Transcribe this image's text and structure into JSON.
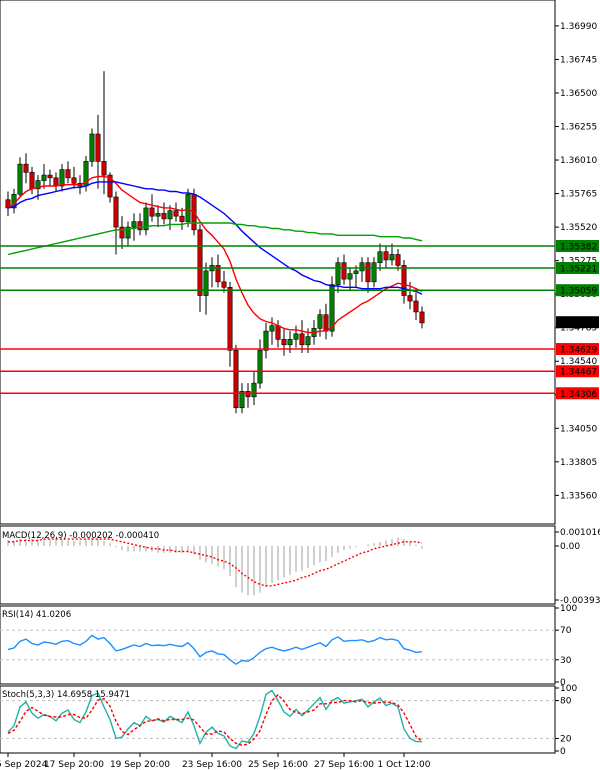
{
  "chart_data": {
    "type": "candlestick",
    "title": "",
    "main_panel": {
      "y_axis_ticks": [
        "1.36990",
        "1.36745",
        "1.36500",
        "1.36255",
        "1.36010",
        "1.35765",
        "1.35520",
        "1.35275",
        "1.35030",
        "1.34785",
        "1.34540",
        "1.34295",
        "1.34050",
        "1.33805",
        "1.33560"
      ],
      "ylim": [
        1.3338,
        1.3715
      ],
      "current_price": "1.34825",
      "current_price_value": 1.34825,
      "horizontal_levels": [
        {
          "label": "1.35382",
          "value": 1.35382,
          "color": "#008000"
        },
        {
          "label": "1.35221",
          "value": 1.35221,
          "color": "#008000"
        },
        {
          "label": "1.35059",
          "value": 1.35059,
          "color": "#008000"
        },
        {
          "label": "1.34629",
          "value": 1.34629,
          "color": "#ff0000"
        },
        {
          "label": "1.34467",
          "value": 1.34467,
          "color": "#ff0000"
        },
        {
          "label": "1.34306",
          "value": 1.34306,
          "color": "#ff0000"
        }
      ],
      "candles": [
        [
          1.3572,
          1.3578,
          1.356,
          1.3566
        ],
        [
          1.3566,
          1.358,
          1.3562,
          1.3576
        ],
        [
          1.3576,
          1.3603,
          1.3574,
          1.3598
        ],
        [
          1.3598,
          1.3606,
          1.3584,
          1.3592
        ],
        [
          1.3592,
          1.3596,
          1.3576,
          1.358
        ],
        [
          1.358,
          1.359,
          1.3572,
          1.3586
        ],
        [
          1.3586,
          1.3598,
          1.358,
          1.359
        ],
        [
          1.359,
          1.3594,
          1.3582,
          1.3588
        ],
        [
          1.3588,
          1.3592,
          1.3578,
          1.3582
        ],
        [
          1.3582,
          1.3598,
          1.3578,
          1.3594
        ],
        [
          1.3594,
          1.36,
          1.3584,
          1.3588
        ],
        [
          1.3588,
          1.3596,
          1.358,
          1.3584
        ],
        [
          1.3584,
          1.359,
          1.3576,
          1.3582
        ],
        [
          1.3582,
          1.3604,
          1.3578,
          1.36
        ],
        [
          1.36,
          1.3624,
          1.3596,
          1.362
        ],
        [
          1.362,
          1.3634,
          1.358,
          1.36
        ],
        [
          1.36,
          1.3666,
          1.3576,
          1.359
        ],
        [
          1.359,
          1.3592,
          1.357,
          1.3574
        ],
        [
          1.3574,
          1.3578,
          1.3532,
          1.3552
        ],
        [
          1.3552,
          1.356,
          1.3536,
          1.3544
        ],
        [
          1.3544,
          1.3556,
          1.3538,
          1.3552
        ],
        [
          1.3552,
          1.3562,
          1.3542,
          1.3556
        ],
        [
          1.3556,
          1.3562,
          1.3546,
          1.355
        ],
        [
          1.355,
          1.357,
          1.3546,
          1.3566
        ],
        [
          1.3566,
          1.3576,
          1.3556,
          1.356
        ],
        [
          1.356,
          1.3568,
          1.3552,
          1.3562
        ],
        [
          1.3562,
          1.357,
          1.3554,
          1.3558
        ],
        [
          1.3558,
          1.3568,
          1.355,
          1.3564
        ],
        [
          1.3564,
          1.357,
          1.3556,
          1.356
        ],
        [
          1.356,
          1.3566,
          1.355,
          1.3556
        ],
        [
          1.3556,
          1.358,
          1.3552,
          1.3576
        ],
        [
          1.3576,
          1.358,
          1.3546,
          1.355
        ],
        [
          1.355,
          1.3554,
          1.349,
          1.3502
        ],
        [
          1.3502,
          1.3526,
          1.3488,
          1.352
        ],
        [
          1.352,
          1.353,
          1.3508,
          1.3524
        ],
        [
          1.3524,
          1.3532,
          1.3508,
          1.3512
        ],
        [
          1.3512,
          1.352,
          1.3504,
          1.3508
        ],
        [
          1.3508,
          1.3512,
          1.345,
          1.3462
        ],
        [
          1.3462,
          1.3466,
          1.3416,
          1.342
        ],
        [
          1.342,
          1.3438,
          1.3416,
          1.3432
        ],
        [
          1.3432,
          1.3438,
          1.342,
          1.3428
        ],
        [
          1.3428,
          1.3446,
          1.3422,
          1.3438
        ],
        [
          1.3438,
          1.347,
          1.3434,
          1.3462
        ],
        [
          1.3462,
          1.3482,
          1.3456,
          1.3476
        ],
        [
          1.3476,
          1.3486,
          1.3466,
          1.348
        ],
        [
          1.348,
          1.3484,
          1.3464,
          1.347
        ],
        [
          1.347,
          1.3478,
          1.3458,
          1.3466
        ],
        [
          1.3466,
          1.3476,
          1.346,
          1.347
        ],
        [
          1.347,
          1.348,
          1.3464,
          1.3474
        ],
        [
          1.3474,
          1.3484,
          1.346,
          1.3466
        ],
        [
          1.3466,
          1.3478,
          1.346,
          1.3472
        ],
        [
          1.3472,
          1.3484,
          1.3466,
          1.3478
        ],
        [
          1.3478,
          1.3492,
          1.3472,
          1.3488
        ],
        [
          1.3488,
          1.3496,
          1.347,
          1.3476
        ],
        [
          1.3476,
          1.3516,
          1.3472,
          1.351
        ],
        [
          1.351,
          1.353,
          1.3504,
          1.3526
        ],
        [
          1.3526,
          1.3532,
          1.351,
          1.3514
        ],
        [
          1.3514,
          1.3522,
          1.3506,
          1.3518
        ],
        [
          1.3518,
          1.3524,
          1.3508,
          1.352
        ],
        [
          1.352,
          1.353,
          1.3512,
          1.3526
        ],
        [
          1.3526,
          1.353,
          1.3504,
          1.3512
        ],
        [
          1.3512,
          1.353,
          1.3508,
          1.3526
        ],
        [
          1.3526,
          1.354,
          1.352,
          1.3534
        ],
        [
          1.3534,
          1.3538,
          1.3522,
          1.3528
        ],
        [
          1.3528,
          1.354,
          1.3524,
          1.3532
        ],
        [
          1.3532,
          1.3536,
          1.352,
          1.3524
        ],
        [
          1.3524,
          1.3528,
          1.3496,
          1.3502
        ],
        [
          1.3502,
          1.3512,
          1.3492,
          1.3498
        ],
        [
          1.3498,
          1.3504,
          1.3484,
          1.349
        ],
        [
          1.349,
          1.3494,
          1.3478,
          1.3482
        ]
      ],
      "series": [
        {
          "name": "",
          "color": "#ff0000",
          "values": [
            1.3566,
            1.3569,
            1.3574,
            1.3578,
            1.358,
            1.3581,
            1.3582,
            1.3582,
            1.3582,
            1.3583,
            1.3583,
            1.3583,
            1.3583,
            1.3585,
            1.3588,
            1.3589,
            1.3589,
            1.3588,
            1.3584,
            1.3579,
            1.3576,
            1.3573,
            1.357,
            1.3569,
            1.3568,
            1.3567,
            1.3566,
            1.3566,
            1.3565,
            1.3564,
            1.3565,
            1.3563,
            1.3556,
            1.355,
            1.3546,
            1.3541,
            1.3536,
            1.3527,
            1.3514,
            1.3504,
            1.3495,
            1.3489,
            1.3485,
            1.3483,
            1.3482,
            1.348,
            1.3478,
            1.3477,
            1.3477,
            1.3476,
            1.3475,
            1.3475,
            1.3476,
            1.3476,
            1.3479,
            1.3484,
            1.3487,
            1.349,
            1.3493,
            1.3496,
            1.3498,
            1.3501,
            1.3504,
            1.3507,
            1.3509,
            1.3511,
            1.351,
            1.3509,
            1.3507,
            1.3505
          ]
        },
        {
          "name": "",
          "color": "#0000ff",
          "values": [
            1.3566,
            1.3567,
            1.357,
            1.3572,
            1.3573,
            1.3575,
            1.3576,
            1.3577,
            1.3578,
            1.3579,
            1.358,
            1.3581,
            1.3581,
            1.3582,
            1.3584,
            1.3585,
            1.3585,
            1.3585,
            1.3585,
            1.3584,
            1.3583,
            1.3582,
            1.3581,
            1.358,
            1.358,
            1.3579,
            1.3579,
            1.3578,
            1.3578,
            1.3577,
            1.3577,
            1.3576,
            1.3574,
            1.3571,
            1.3568,
            1.3565,
            1.3562,
            1.3558,
            1.3554,
            1.3549,
            1.3545,
            1.3541,
            1.3537,
            1.3534,
            1.3531,
            1.3528,
            1.3525,
            1.3522,
            1.352,
            1.3517,
            1.3515,
            1.3513,
            1.3512,
            1.351,
            1.3509,
            1.3509,
            1.3508,
            1.3508,
            1.3508,
            1.3507,
            1.3507,
            1.3507,
            1.3507,
            1.3508,
            1.3508,
            1.3508,
            1.3507,
            1.3506,
            1.3505,
            1.3503
          ]
        },
        {
          "name": "",
          "color": "#00a000",
          "values": [
            1.3532,
            1.3533,
            1.3534,
            1.3535,
            1.3536,
            1.3537,
            1.3538,
            1.3539,
            1.354,
            1.3541,
            1.3542,
            1.3543,
            1.3544,
            1.3545,
            1.3546,
            1.3547,
            1.3548,
            1.3549,
            1.355,
            1.355,
            1.3551,
            1.3551,
            1.3552,
            1.3552,
            1.3553,
            1.3553,
            1.3553,
            1.3554,
            1.3554,
            1.3554,
            1.3555,
            1.3555,
            1.3555,
            1.3555,
            1.3555,
            1.3555,
            1.3555,
            1.3555,
            1.3554,
            1.3554,
            1.3553,
            1.3553,
            1.3552,
            1.3552,
            1.3551,
            1.3551,
            1.355,
            1.355,
            1.3549,
            1.3549,
            1.3548,
            1.3548,
            1.3547,
            1.3547,
            1.3547,
            1.3546,
            1.3546,
            1.3546,
            1.3546,
            1.3546,
            1.3546,
            1.3546,
            1.3545,
            1.3545,
            1.3545,
            1.3545,
            1.3544,
            1.3544,
            1.3543,
            1.3542
          ]
        }
      ]
    },
    "macd_panel": {
      "label": "MACD(12,26,9) -0.000202 -0.000410",
      "y_axis_ticks": [
        "0.001016",
        "0.00",
        "-0.003935"
      ],
      "ylim": [
        -0.003935,
        0.001016
      ],
      "histogram": [
        0.0004,
        0.0004,
        0.0005,
        0.0005,
        0.0005,
        0.0005,
        0.0005,
        0.0005,
        0.0005,
        0.0005,
        0.0004,
        0.0004,
        0.0004,
        0.0005,
        0.0006,
        0.0005,
        0.0004,
        0.0002,
        -0.0001,
        -0.0003,
        -0.0004,
        -0.0004,
        -0.0004,
        -0.0004,
        -0.0004,
        -0.0005,
        -0.0005,
        -0.0005,
        -0.0005,
        -0.0005,
        -0.0005,
        -0.0006,
        -0.001,
        -0.0012,
        -0.0013,
        -0.0015,
        -0.0017,
        -0.0022,
        -0.003,
        -0.0034,
        -0.0036,
        -0.0036,
        -0.0034,
        -0.003,
        -0.0027,
        -0.0025,
        -0.0023,
        -0.0021,
        -0.0019,
        -0.0018,
        -0.0016,
        -0.0014,
        -0.0012,
        -0.0011,
        -0.0008,
        -0.0005,
        -0.0003,
        -0.0002,
        -0.0001,
        0.0,
        0.0001,
        0.0002,
        0.0003,
        0.0004,
        0.0005,
        0.0006,
        0.0005,
        0.0003,
        0.0001,
        -0.0002
      ],
      "signal": [
        0.0003,
        0.0003,
        0.0004,
        0.0004,
        0.0004,
        0.0004,
        0.0005,
        0.0005,
        0.0005,
        0.0005,
        0.0005,
        0.0005,
        0.0005,
        0.0005,
        0.0005,
        0.0005,
        0.0005,
        0.0005,
        0.0004,
        0.0003,
        0.0002,
        0.0001,
        0.0,
        -0.0001,
        -0.0002,
        -0.0002,
        -0.0003,
        -0.0003,
        -0.0004,
        -0.0004,
        -0.0004,
        -0.0005,
        -0.0006,
        -0.0007,
        -0.0008,
        -0.001,
        -0.0011,
        -0.0013,
        -0.0016,
        -0.002,
        -0.0023,
        -0.0026,
        -0.0028,
        -0.0029,
        -0.0029,
        -0.0028,
        -0.0027,
        -0.0026,
        -0.0025,
        -0.0023,
        -0.0022,
        -0.002,
        -0.0018,
        -0.0017,
        -0.0015,
        -0.0013,
        -0.0011,
        -0.0009,
        -0.0007,
        -0.0005,
        -0.0004,
        -0.0002,
        -0.0001,
        0.0,
        0.0001,
        0.0002,
        0.0003,
        0.0003,
        0.0003,
        0.0002
      ]
    },
    "rsi_panel": {
      "label": "RSI(14) 41.0206",
      "y_axis_ticks": [
        "100",
        "70",
        "30",
        "0"
      ],
      "ylim": [
        0,
        100
      ],
      "values": [
        44,
        46,
        55,
        58,
        52,
        50,
        54,
        53,
        51,
        55,
        56,
        52,
        50,
        55,
        63,
        58,
        60,
        52,
        42,
        44,
        47,
        50,
        48,
        52,
        49,
        50,
        49,
        51,
        49,
        48,
        53,
        45,
        34,
        40,
        42,
        38,
        37,
        30,
        24,
        29,
        28,
        33,
        40,
        45,
        47,
        44,
        42,
        44,
        47,
        44,
        47,
        50,
        53,
        48,
        57,
        61,
        55,
        56,
        56,
        57,
        54,
        56,
        60,
        57,
        58,
        56,
        45,
        43,
        40,
        41
      ]
    },
    "stoch_panel": {
      "label": "Stoch(5,3,3) 14.6958 15.9471",
      "y_axis_ticks": [
        "100",
        "80",
        "20",
        "0"
      ],
      "ylim": [
        0,
        100
      ],
      "main": [
        30,
        40,
        70,
        78,
        60,
        52,
        58,
        55,
        48,
        60,
        65,
        50,
        45,
        62,
        88,
        92,
        70,
        50,
        20,
        22,
        35,
        45,
        40,
        55,
        48,
        50,
        46,
        55,
        50,
        45,
        62,
        40,
        12,
        30,
        38,
        28,
        24,
        8,
        4,
        16,
        14,
        28,
        55,
        90,
        96,
        80,
        62,
        55,
        66,
        56,
        65,
        75,
        85,
        66,
        80,
        85,
        76,
        78,
        80,
        82,
        70,
        78,
        84,
        72,
        76,
        70,
        35,
        20,
        15,
        14.7
      ],
      "signal": [
        28,
        33,
        47,
        63,
        69,
        63,
        57,
        55,
        54,
        54,
        58,
        58,
        53,
        52,
        65,
        81,
        83,
        71,
        47,
        31,
        26,
        34,
        40,
        47,
        48,
        51,
        48,
        50,
        50,
        50,
        52,
        49,
        38,
        27,
        27,
        32,
        30,
        20,
        12,
        9,
        11,
        19,
        32,
        58,
        80,
        89,
        79,
        66,
        61,
        59,
        62,
        65,
        75,
        75,
        77,
        77,
        80,
        80,
        78,
        80,
        77,
        76,
        77,
        78,
        77,
        73,
        60,
        42,
        23,
        15.9
      ]
    },
    "x_axis_labels": [
      {
        "label": "5 Sep 2024",
        "index": 0
      },
      {
        "label": "17 Sep 20:00",
        "index": 11
      },
      {
        "label": "19 Sep 20:00",
        "index": 22
      },
      {
        "label": "23 Sep 16:00",
        "index": 34
      },
      {
        "label": "25 Sep 16:00",
        "index": 45
      },
      {
        "label": "27 Sep 16:00",
        "index": 56
      },
      {
        "label": "1 Oct 12:00",
        "index": 66
      }
    ]
  }
}
